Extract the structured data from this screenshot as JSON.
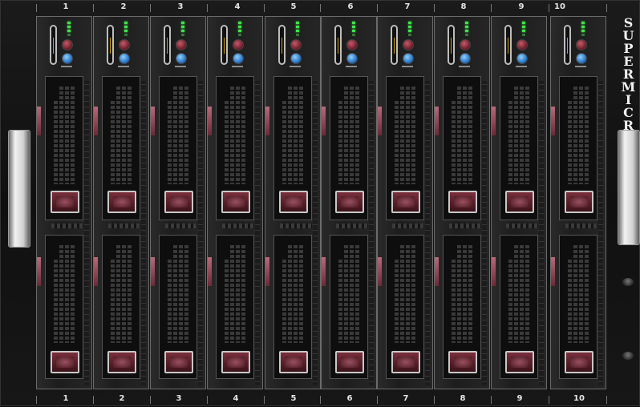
{
  "chassis": {
    "brand": "SUPERMICR",
    "brand_logo_icon": "supermicro-logo-icon"
  },
  "slots": [
    {
      "label": "1"
    },
    {
      "label": "2"
    },
    {
      "label": "3"
    },
    {
      "label": "4"
    },
    {
      "label": "5"
    },
    {
      "label": "6"
    },
    {
      "label": "7"
    },
    {
      "label": "8"
    },
    {
      "label": "9"
    },
    {
      "label": "10"
    }
  ],
  "colors": {
    "status_led": "#3fe24a",
    "power_button": "#8a2a3a",
    "id_button": "#2a88e0",
    "latch": "#6b2533"
  }
}
